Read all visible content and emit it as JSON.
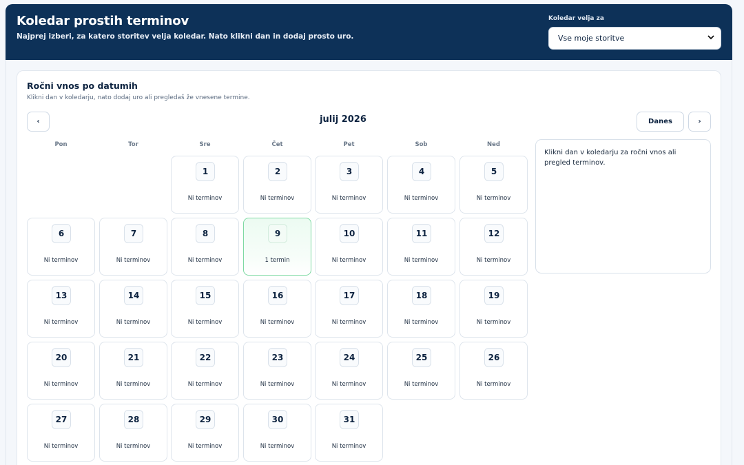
{
  "header": {
    "title": "Koledar prostih terminov",
    "subtitle": "Najprej izberi, za katero storitev velja koledar. Nato klikni dan in dodaj prosto uro.",
    "select_label": "Koledar velja za",
    "select_value": "Vse moje storitve"
  },
  "card": {
    "title": "Ročni vnos po datumih",
    "subtitle": "Klikni dan v koledarju, nato dodaj uro ali pregledaš že vnesene termine."
  },
  "nav": {
    "prev": "‹",
    "today": "Danes",
    "next": "›",
    "month": "julij 2026"
  },
  "weekdays": [
    "Pon",
    "Tor",
    "Sre",
    "Čet",
    "Pet",
    "Sob",
    "Ned"
  ],
  "side_panel": {
    "text": "Klikni dan v koledarju za ročni vnos ali pregled terminov."
  },
  "calendar": {
    "first_weekday_index": 2,
    "days": [
      {
        "n": "1",
        "status": "Ni terminov"
      },
      {
        "n": "2",
        "status": "Ni terminov"
      },
      {
        "n": "3",
        "status": "Ni terminov"
      },
      {
        "n": "4",
        "status": "Ni terminov"
      },
      {
        "n": "5",
        "status": "Ni terminov"
      },
      {
        "n": "6",
        "status": "Ni terminov"
      },
      {
        "n": "7",
        "status": "Ni terminov"
      },
      {
        "n": "8",
        "status": "Ni terminov"
      },
      {
        "n": "9",
        "status": "1 termin",
        "has": true
      },
      {
        "n": "10",
        "status": "Ni terminov"
      },
      {
        "n": "11",
        "status": "Ni terminov"
      },
      {
        "n": "12",
        "status": "Ni terminov"
      },
      {
        "n": "13",
        "status": "Ni terminov"
      },
      {
        "n": "14",
        "status": "Ni terminov"
      },
      {
        "n": "15",
        "status": "Ni terminov"
      },
      {
        "n": "16",
        "status": "Ni terminov"
      },
      {
        "n": "17",
        "status": "Ni terminov"
      },
      {
        "n": "18",
        "status": "Ni terminov"
      },
      {
        "n": "19",
        "status": "Ni terminov"
      },
      {
        "n": "20",
        "status": "Ni terminov"
      },
      {
        "n": "21",
        "status": "Ni terminov"
      },
      {
        "n": "22",
        "status": "Ni terminov"
      },
      {
        "n": "23",
        "status": "Ni terminov"
      },
      {
        "n": "24",
        "status": "Ni terminov"
      },
      {
        "n": "25",
        "status": "Ni terminov"
      },
      {
        "n": "26",
        "status": "Ni terminov"
      },
      {
        "n": "27",
        "status": "Ni terminov"
      },
      {
        "n": "28",
        "status": "Ni terminov"
      },
      {
        "n": "29",
        "status": "Ni terminov"
      },
      {
        "n": "30",
        "status": "Ni terminov"
      },
      {
        "n": "31",
        "status": "Ni terminov"
      }
    ]
  },
  "icons": {
    "select_chevron": "chevron-down-icon"
  },
  "colors": {
    "header_bg": "#0d3158",
    "has_termin_border": "#7ed9a3",
    "has_termin_bg": "#ecfbf2"
  }
}
